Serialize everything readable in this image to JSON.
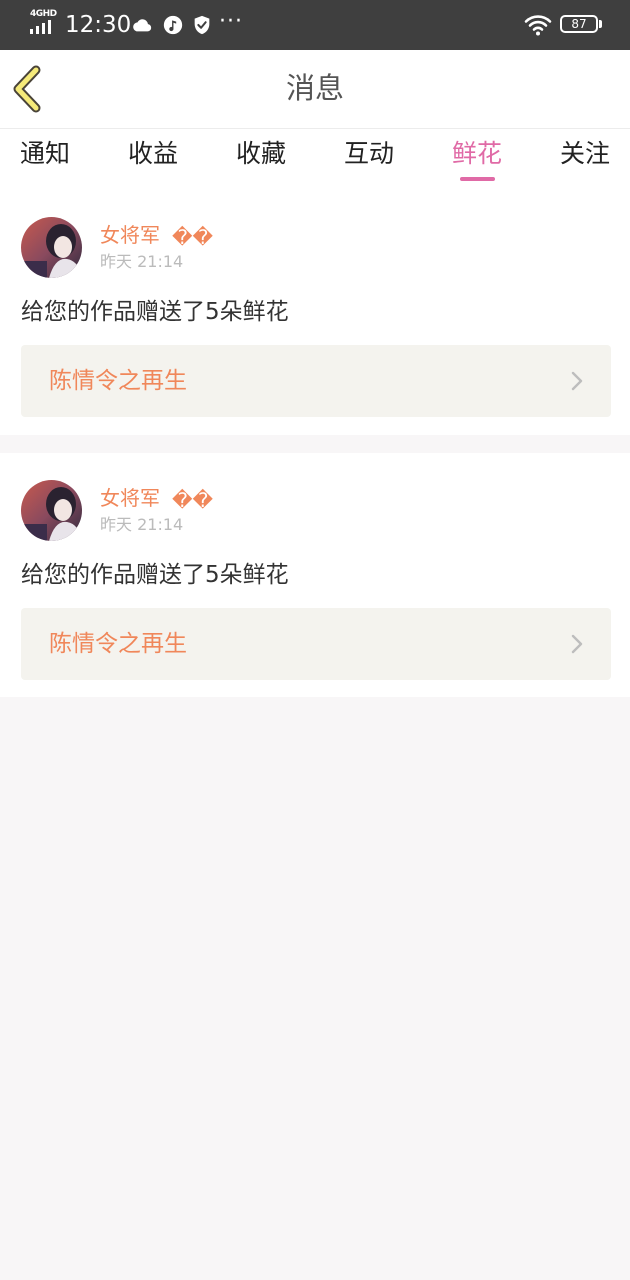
{
  "status_bar": {
    "network": "4GHD",
    "time": "12:30",
    "more": "···",
    "battery": "87"
  },
  "header": {
    "title": "消息"
  },
  "tabs": [
    {
      "label": "通知"
    },
    {
      "label": "收益"
    },
    {
      "label": "收藏"
    },
    {
      "label": "互动"
    },
    {
      "label": "鲜花",
      "active": true
    },
    {
      "label": "关注"
    }
  ],
  "messages": [
    {
      "user": "女将军",
      "badge": "��",
      "time": "昨天 21:14",
      "text": "给您的作品赠送了5朵鲜花",
      "work_title": "陈情令之再生"
    },
    {
      "user": "女将军",
      "badge": "��",
      "time": "昨天 21:14",
      "text": "给您的作品赠送了5朵鲜花",
      "work_title": "陈情令之再生"
    }
  ],
  "colors": {
    "accent_pink": "#e06aa6",
    "accent_orange": "#f0875a",
    "back_arrow_yellow": "#f5ea7a",
    "status_bar_bg": "#3f3f3f"
  },
  "icons": {
    "back": "chevron-left-icon",
    "weather": "cloud-icon",
    "music": "music-note-icon",
    "security": "shield-check-icon",
    "wifi": "wifi-icon",
    "battery": "battery-icon",
    "chevron": "chevron-right-icon"
  }
}
